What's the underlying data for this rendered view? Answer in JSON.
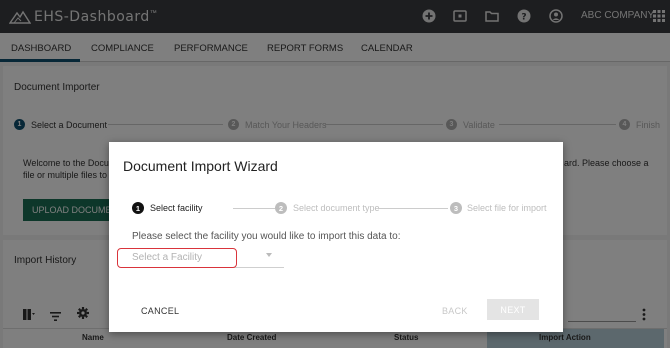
{
  "app": {
    "logo_text": "EHS-Dashboard",
    "trademark": "™",
    "company": "ABC COMPANY",
    "topbar_icons": [
      "add-circle-icon",
      "monitor-icon",
      "folder-icon",
      "help-icon",
      "user-icon",
      "apps-grid-icon"
    ]
  },
  "nav": {
    "items": [
      "DASHBOARD",
      "COMPLIANCE",
      "PERFORMANCE",
      "REPORT FORMS",
      "CALENDAR"
    ],
    "active": "DASHBOARD"
  },
  "importer": {
    "title": "Document Importer",
    "steps": [
      {
        "num": "1",
        "label": "Select a Document"
      },
      {
        "num": "2",
        "label": "Match Your Headers"
      },
      {
        "num": "3",
        "label": "Validate"
      },
      {
        "num": "4",
        "label": "Finish"
      }
    ],
    "welcome_line1": "Welcome to the Docum",
    "welcome_line2": "file or multiple files to w",
    "welcome_right": "ard. Please choose a",
    "upload_label": "UPLOAD DOCUMEN"
  },
  "history": {
    "title": "Import History",
    "columns": [
      "Name",
      "Date Created",
      "Status",
      "Import Action"
    ]
  },
  "dialog": {
    "title": "Document Import Wizard",
    "steps": [
      {
        "num": "1",
        "label": "Select facility"
      },
      {
        "num": "2",
        "label": "Select document type"
      },
      {
        "num": "3",
        "label": "Select file for import"
      }
    ],
    "prompt": "Please select the facility you would like to import this data to:",
    "facility_placeholder": "Select a Facility",
    "cancel": "CANCEL",
    "back": "BACK",
    "next": "NEXT"
  },
  "colors": {
    "topbar": "#3a3d40",
    "accent": "#0f4f6e",
    "upload_button": "#1b6e55",
    "highlight": "#d9343b"
  }
}
